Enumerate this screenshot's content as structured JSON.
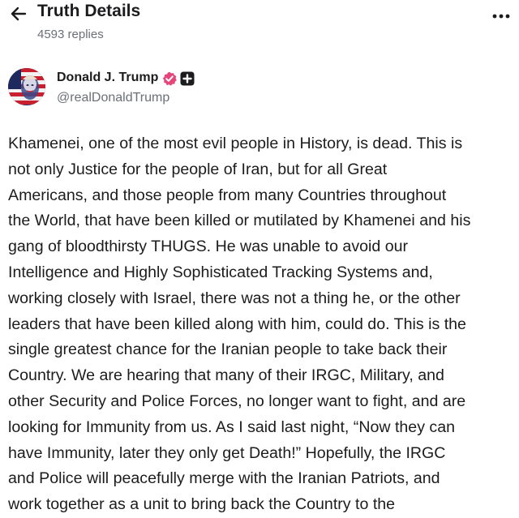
{
  "header": {
    "title": "Truth Details",
    "subtitle": "4593 replies"
  },
  "author": {
    "name": "Donald J. Trump",
    "handle": "@realDonaldTrump",
    "verified_color": "#e4467a"
  },
  "post": {
    "lines": [
      "Khamenei, one of the most evil people in History, is dead. This is",
      "not only Justice for the people of Iran, but for all Great",
      "Americans, and those people from many Countries throughout",
      "the World, that have been killed or mutilated by Khamenei and his",
      "gang of bloodthirsty THUGS. He was unable to avoid our",
      "Intelligence and Highly Sophisticated Tracking Systems and,",
      "working closely with Israel, there was not a thing he, or the other",
      "leaders that have been killed along with him, could do. This is the",
      "single greatest chance for the Iranian people to take back their",
      "Country. We are hearing that many of their IRGC, Military, and",
      "other Security and Police Forces, no longer want to fight, and are",
      "looking for Immunity from us. As I said last night, “Now they can",
      "have Immunity, later they only get Death!” Hopefully, the IRGC",
      "and Police will peacefully merge with the Iranian Patriots, and",
      "work together as a unit to bring back the Country to the"
    ]
  },
  "icons": {
    "back": "arrow-left-icon",
    "more": "more-horizontal-icon",
    "verified": "verified-badge-icon",
    "plus": "plus-badge-icon"
  }
}
